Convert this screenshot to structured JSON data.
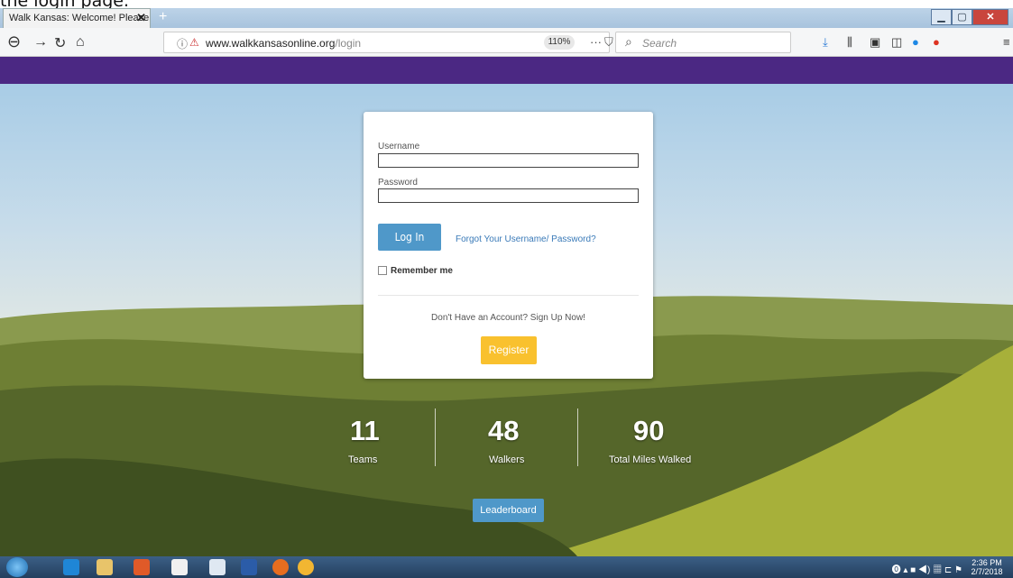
{
  "caption": "the login page.",
  "browser": {
    "tab_title": "Walk Kansas: Welcome! Please log",
    "url_host": "www.walkkansasonline.org",
    "url_path": "/login",
    "zoom": "110%",
    "search_placeholder": "Search"
  },
  "login": {
    "username_label": "Username",
    "password_label": "Password",
    "login_button": "Log In",
    "forgot_link": "Forgot Your Username/ Password?",
    "remember_label": "Remember me",
    "signup_text": "Don't Have an Account? Sign Up Now!",
    "register_button": "Register"
  },
  "stats": [
    {
      "value": "11",
      "label": "Teams"
    },
    {
      "value": "48",
      "label": "Walkers"
    },
    {
      "value": "90",
      "label": "Total Miles Walked"
    }
  ],
  "leaderboard_button": "Leaderboard",
  "taskbar": {
    "time": "2:36 PM",
    "date": "2/7/2018"
  },
  "colors": {
    "accent_blue": "#4f98c9",
    "register_yellow": "#f9c12e",
    "header_purple": "#4b2883"
  }
}
